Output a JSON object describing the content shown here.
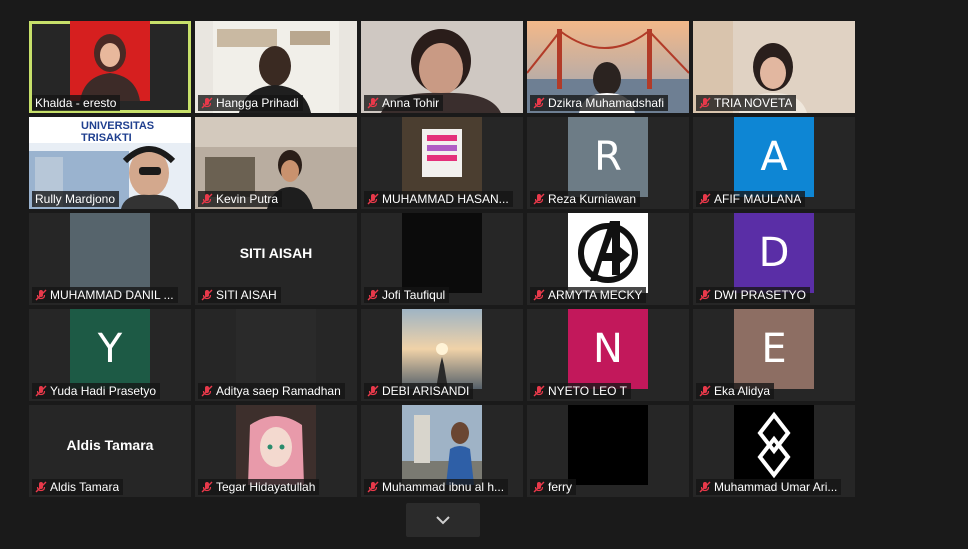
{
  "participants": [
    {
      "name": "Khalda - eresto",
      "muted": false,
      "kind": "video",
      "active": true
    },
    {
      "name": "Hangga Prihadi",
      "muted": true,
      "kind": "video"
    },
    {
      "name": "Anna Tohir",
      "muted": true,
      "kind": "video"
    },
    {
      "name": "Dzikra Muhamadshafi",
      "muted": true,
      "kind": "video"
    },
    {
      "name": "TRIA NOVETA",
      "muted": true,
      "kind": "video"
    },
    {
      "name": "Rully Mardjono",
      "muted": false,
      "kind": "video",
      "banner": "UNIVERSITAS TRISAKTI"
    },
    {
      "name": "Kevin Putra",
      "muted": true,
      "kind": "video"
    },
    {
      "name": "MUHAMMAD HASAN...",
      "muted": true,
      "kind": "picture"
    },
    {
      "name": "Reza Kurniawan",
      "muted": true,
      "kind": "letter",
      "letter": "R",
      "color": "#6d7c86"
    },
    {
      "name": "AFIF MAULANA",
      "muted": true,
      "kind": "letter",
      "letter": "A",
      "color": "#0e86d4"
    },
    {
      "name": "MUHAMMAD DANIL ...",
      "muted": true,
      "kind": "picture"
    },
    {
      "name": "SITI AISAH",
      "muted": true,
      "kind": "name",
      "display": "SITI AISAH"
    },
    {
      "name": "Jofi Taufiqul",
      "muted": true,
      "kind": "picture"
    },
    {
      "name": "ARMYTA MECKY",
      "muted": true,
      "kind": "picture"
    },
    {
      "name": "DWI PRASETYO",
      "muted": true,
      "kind": "letter",
      "letter": "D",
      "color": "#5a2ea6"
    },
    {
      "name": "Yuda Hadi Prasetyo",
      "muted": true,
      "kind": "letter",
      "letter": "Y",
      "color": "#1d5a45"
    },
    {
      "name": "Aditya saep Ramadhan",
      "muted": true,
      "kind": "picture"
    },
    {
      "name": "DEBI ARISANDI",
      "muted": true,
      "kind": "picture"
    },
    {
      "name": "NYETO LEO T",
      "muted": true,
      "kind": "letter",
      "letter": "N",
      "color": "#c2185b"
    },
    {
      "name": "Eka Alidya",
      "muted": true,
      "kind": "letter",
      "letter": "E",
      "color": "#8d6e63"
    },
    {
      "name": "Aldis Tamara",
      "muted": true,
      "kind": "name",
      "display": "Aldis Tamara"
    },
    {
      "name": "Tegar Hidayatullah",
      "muted": true,
      "kind": "picture"
    },
    {
      "name": "Muhammad ibnu al h...",
      "muted": true,
      "kind": "picture"
    },
    {
      "name": "ferry",
      "muted": true,
      "kind": "picture"
    },
    {
      "name": "Muhammad Umar Ari...",
      "muted": true,
      "kind": "picture"
    }
  ],
  "colors": {
    "active_outline": "#c7e06a",
    "muted_icon": "#e8394a",
    "tile_bg": "#262626"
  },
  "controls": {
    "more_icon": "chevron-down-icon"
  }
}
